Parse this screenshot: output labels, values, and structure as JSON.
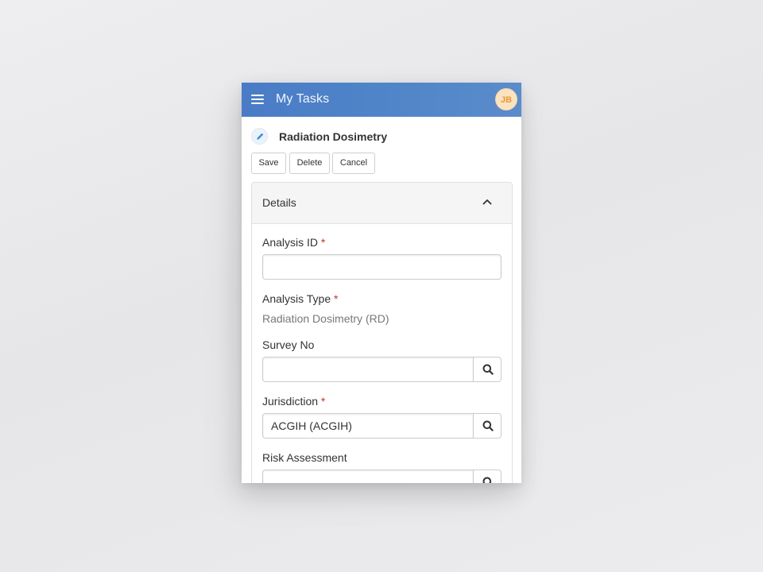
{
  "appbar": {
    "title": "My Tasks",
    "avatar_initials": "JB",
    "menu_icon": "hamburger-menu-icon"
  },
  "record": {
    "title": "Radiation Dosimetry",
    "icon": "pencil-icon"
  },
  "actions": {
    "save_label": "Save",
    "delete_label": "Delete",
    "cancel_label": "Cancel"
  },
  "details": {
    "header": "Details",
    "toggle_icon": "chevron-up-icon",
    "fields": {
      "analysis_id": {
        "label": "Analysis ID",
        "required_mark": "*",
        "value": ""
      },
      "analysis_type": {
        "label": "Analysis Type",
        "required_mark": "*",
        "value": "Radiation Dosimetry (RD)"
      },
      "survey_no": {
        "label": "Survey No",
        "value": ""
      },
      "jurisdiction": {
        "label": "Jurisdiction",
        "required_mark": "*",
        "value": "ACGIH (ACGIH)"
      },
      "risk_assessment": {
        "label": "Risk Assessment",
        "value": ""
      }
    }
  },
  "colors": {
    "appbar": "#4a7cc6",
    "required": "#c9302c",
    "avatar_bg": "#fbe3c2",
    "avatar_text": "#e89a33"
  }
}
